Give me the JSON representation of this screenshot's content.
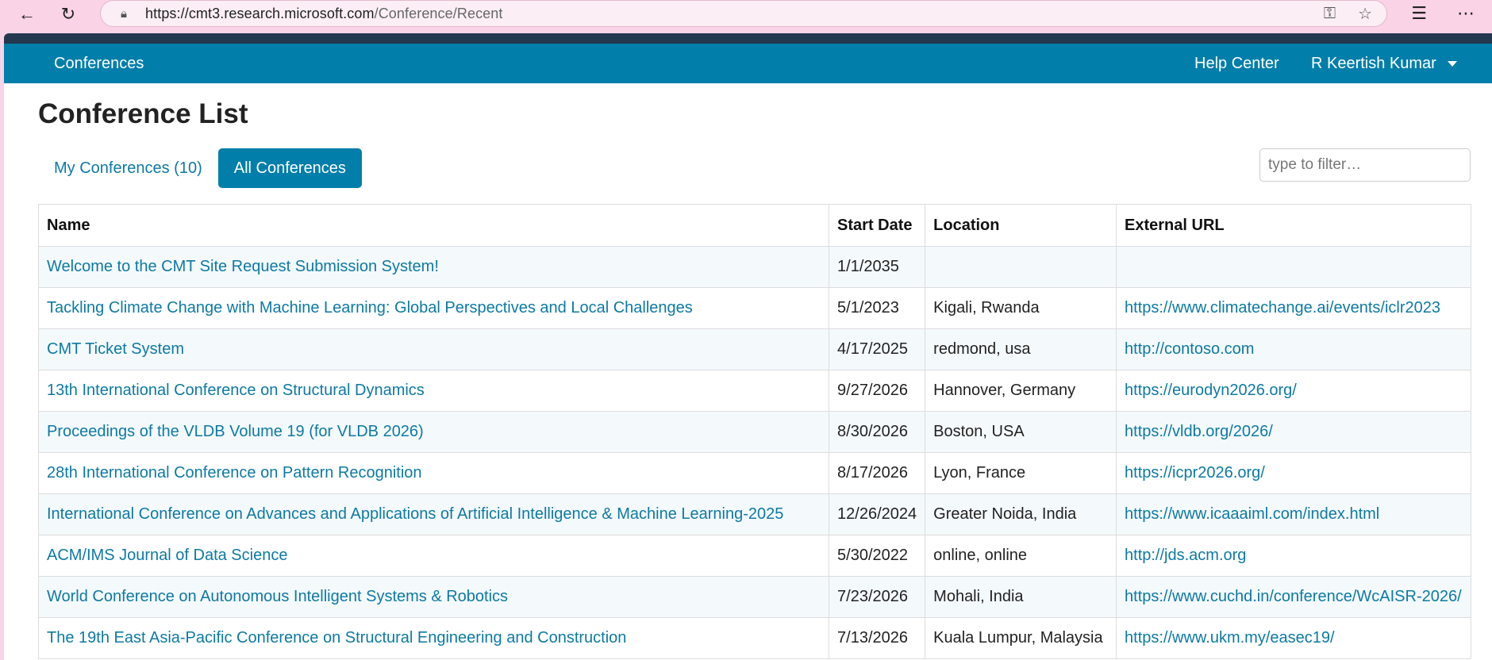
{
  "browser": {
    "url_host": "https://cmt3.research.microsoft.com",
    "url_path": "/Conference/Recent"
  },
  "navbar": {
    "brand": "Conferences",
    "help": "Help Center",
    "user": "R Keertish Kumar"
  },
  "page": {
    "title": "Conference List",
    "tabs": [
      "My Conferences (10)",
      "All Conferences"
    ],
    "active_tab": "All Conferences",
    "filter_placeholder": "type to filter…"
  },
  "table": {
    "headers": [
      "Name",
      "Start Date",
      "Location",
      "External URL"
    ],
    "rows": [
      {
        "name": "Welcome to the CMT Site Request Submission System!",
        "date": "1/1/2035",
        "location": "",
        "url": ""
      },
      {
        "name": "Tackling Climate Change with Machine Learning: Global Perspectives and Local Challenges",
        "date": "5/1/2023",
        "location": "Kigali, Rwanda",
        "url": "https://www.climatechange.ai/events/iclr2023"
      },
      {
        "name": "CMT Ticket System",
        "date": "4/17/2025",
        "location": "redmond, usa",
        "url": "http://contoso.com"
      },
      {
        "name": "13th International Conference on Structural Dynamics",
        "date": "9/27/2026",
        "location": "Hannover, Germany",
        "url": "https://eurodyn2026.org/"
      },
      {
        "name": "Proceedings of the VLDB Volume 19 (for VLDB 2026)",
        "date": "8/30/2026",
        "location": "Boston, USA",
        "url": "https://vldb.org/2026/"
      },
      {
        "name": "28th International Conference on Pattern Recognition",
        "date": "8/17/2026",
        "location": "Lyon, France",
        "url": "https://icpr2026.org/"
      },
      {
        "name": "International Conference on Advances and Applications of Artificial Intelligence & Machine Learning-2025",
        "date": "12/26/2024",
        "location": "Greater Noida, India",
        "url": "https://www.icaaaiml.com/index.html"
      },
      {
        "name": "ACM/IMS Journal of Data Science",
        "date": "5/30/2022",
        "location": "online, online",
        "url": "http://jds.acm.org"
      },
      {
        "name": "World Conference on Autonomous Intelligent Systems & Robotics",
        "date": "7/23/2026",
        "location": "Mohali, India",
        "url": "https://www.cuchd.in/conference/WcAISR-2026/"
      },
      {
        "name": "The 19th East Asia-Pacific Conference on Structural Engineering and Construction",
        "date": "7/13/2026",
        "location": "Kuala Lumpur, Malaysia",
        "url": "https://www.ukm.my/easec19/"
      }
    ]
  },
  "colors": {
    "navbar": "#017ea9",
    "topstrip": "#24374f",
    "link": "#0d7aa3",
    "browser_chrome": "#fad3e6"
  }
}
